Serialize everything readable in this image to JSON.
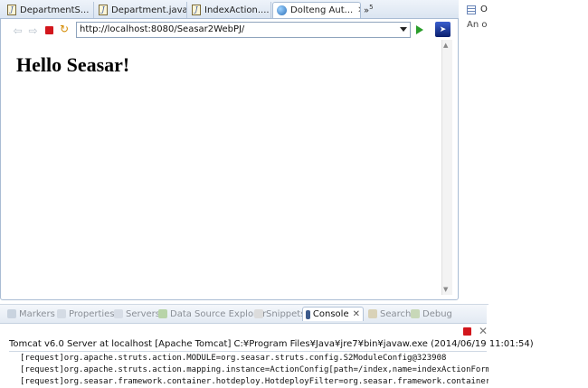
{
  "editor_tabs": [
    {
      "label": "DepartmentS...",
      "icon": "java-file-icon"
    },
    {
      "label": "Department.java",
      "icon": "java-file-icon"
    },
    {
      "label": "IndexAction....",
      "icon": "java-file-icon"
    },
    {
      "label": "Dolteng Aut...",
      "icon": "browser-globe-icon",
      "active": true
    }
  ],
  "overflow_label": "»",
  "overflow_count": "5",
  "close_glyph": "✕",
  "browser": {
    "url": "http://localhost:8080/Seasar2WebPJ/",
    "heading": "Hello Seasar!"
  },
  "outline": {
    "title": "O",
    "message": "An o"
  },
  "bottom_tabs": [
    {
      "label": "Markers",
      "icon": "markers-icon"
    },
    {
      "label": "Properties",
      "icon": "properties-icon"
    },
    {
      "label": "Servers",
      "icon": "servers-icon"
    },
    {
      "label": "Data Source Explorer",
      "icon": "data-source-icon"
    },
    {
      "label": "Snippets",
      "icon": "snippets-icon"
    },
    {
      "label": "Console",
      "icon": "console-icon",
      "active": true
    },
    {
      "label": "Search",
      "icon": "search-icon"
    },
    {
      "label": "Debug",
      "icon": "debug-icon"
    }
  ],
  "console": {
    "header": "Tomcat v6.0 Server at localhost [Apache Tomcat] C:¥Program Files¥Java¥jre7¥bin¥javaw.exe (2014/06/19 11:01:54)",
    "lines": [
      "[request]org.apache.struts.action.MODULE=org.seasar.struts.config.S2ModuleConfig@323908",
      "[request]org.apache.struts.action.mapping.instance=ActionConfig[path=/index,name=indexActionForm,s",
      "[request]org.seasar.framework.container.hotdeploy.HotdeployFilter=org.seasar.framework.container.h"
    ]
  }
}
